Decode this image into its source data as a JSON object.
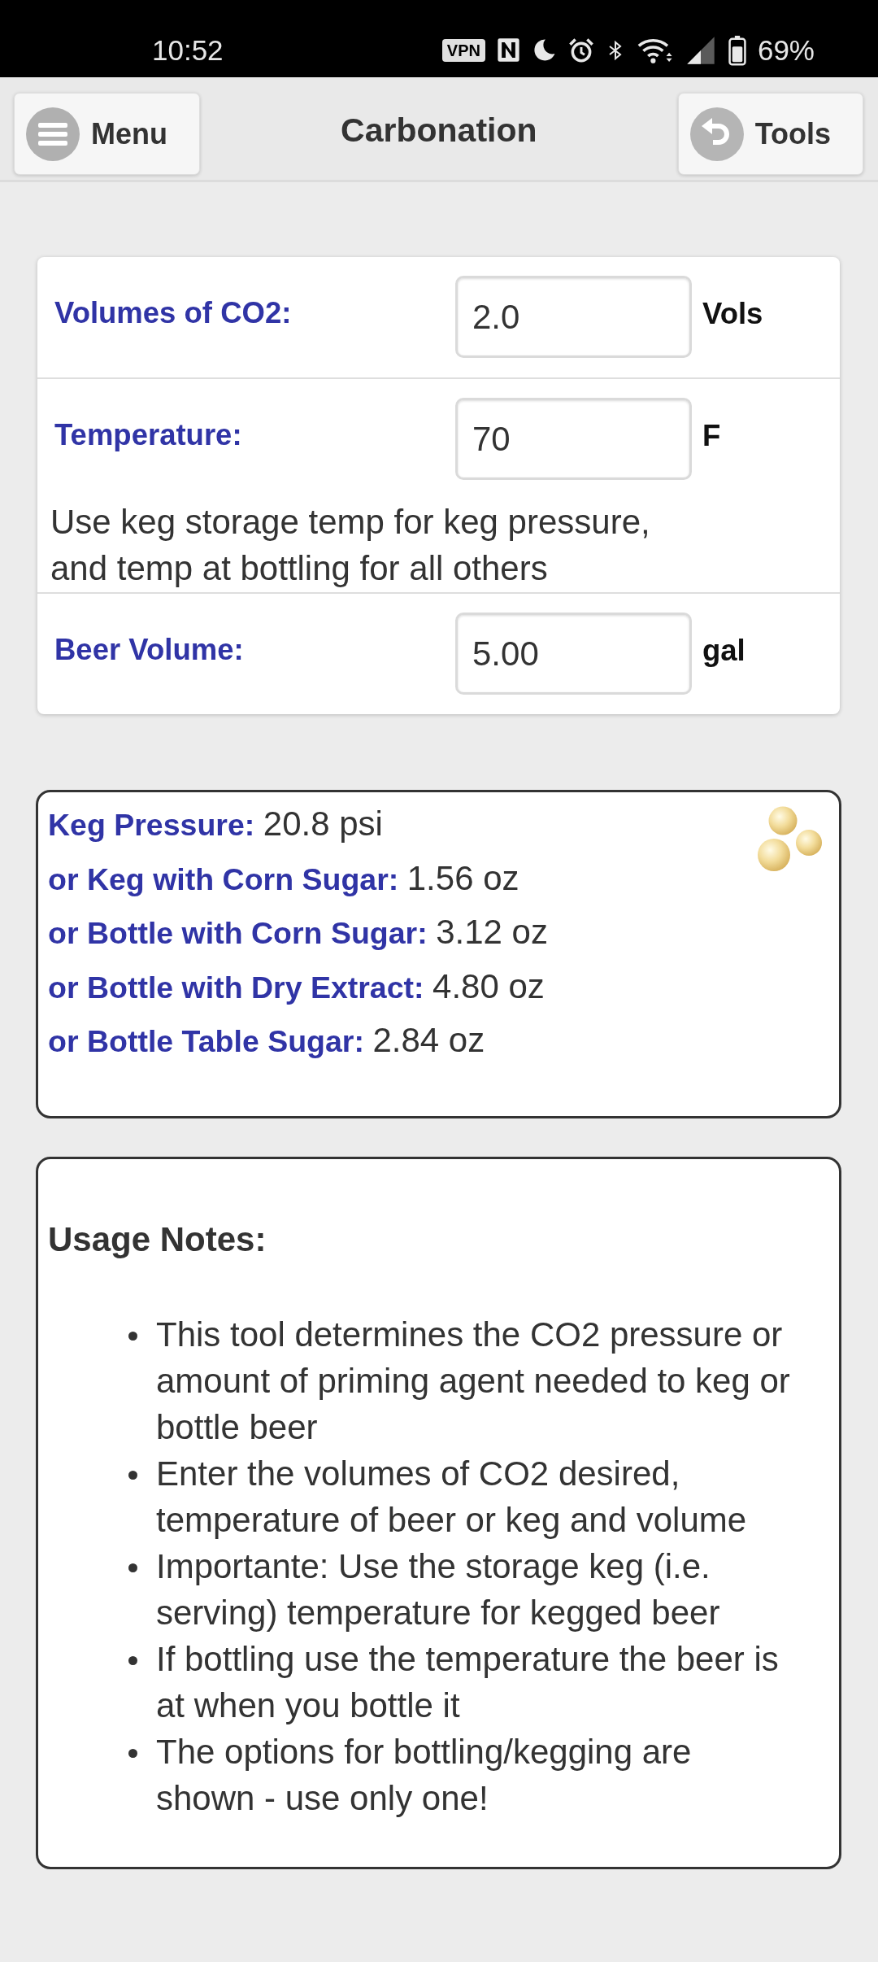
{
  "status_bar": {
    "time": "10:52",
    "vpn": "VPN",
    "battery": "69%"
  },
  "header": {
    "title": "Carbonation",
    "left_button": "Menu",
    "right_button": "Tools"
  },
  "fields": [
    {
      "label": "Volumes of CO2:",
      "value": "2.0",
      "unit": "Vols"
    },
    {
      "label": "Temperature:",
      "value": "70",
      "unit": "F",
      "note": "Use keg storage temp for keg pressure, and temp at bottling for all others"
    },
    {
      "label": "Beer Volume:",
      "value": "5.00",
      "unit": "gal"
    }
  ],
  "results": [
    {
      "label": "Keg Pressure:",
      "value": "20.8 psi"
    },
    {
      "label": "or Keg with Corn Sugar:",
      "value": "1.56 oz"
    },
    {
      "label": "or Bottle with Corn Sugar:",
      "value": "3.12 oz"
    },
    {
      "label": "or Bottle with Dry Extract:",
      "value": "4.80 oz"
    },
    {
      "label": "or Bottle Table Sugar:",
      "value": "2.84 oz"
    }
  ],
  "usage_notes": {
    "title": "Usage Notes:",
    "items": [
      "This tool determines the CO2 pressure or amount of priming agent needed to keg or bottle beer",
      "Enter the volumes of CO2 desired, temperature of beer or keg and volume",
      "Importante: Use the storage keg (i.e. serving) temperature for kegged beer",
      "If bottling use the temperature the beer is at when you bottle it",
      "The options for bottling/kegging are shown - use only one!"
    ]
  }
}
